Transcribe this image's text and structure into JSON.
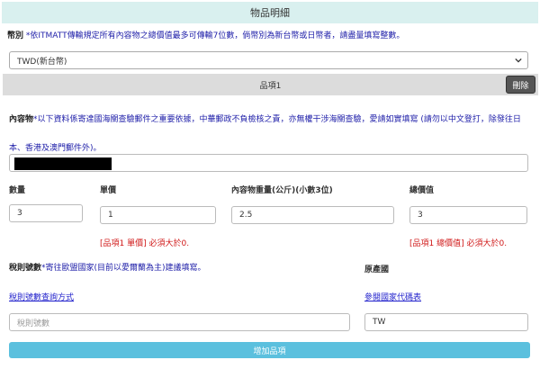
{
  "header": {
    "title": "物品明細"
  },
  "currency": {
    "label": "幣別",
    "note": "*依ITMATT傳輸規定所有內容物之總價值最多可傳輸7位數，倘幣別為新台幣或日幣者，請盡量填寫整數。",
    "selected": "TWD(新台幣)"
  },
  "item": {
    "title": "品項1",
    "delete_label": "刪除",
    "contents_label": "內容物",
    "contents_note": "*以下資料係寄達國海關查驗郵件之重要依據，中華郵政不負檢核之責，亦無權干涉海關查驗，愛請如實填寫 (請勿以中文登打，除發往日本、香港及澳門郵件外)。"
  },
  "fields": {
    "quantity": {
      "label": "數量",
      "value": "3"
    },
    "unit_price": {
      "label": "單價",
      "value": "1",
      "error": "[品項1 單價] 必須大於0."
    },
    "weight": {
      "label": "內容物重量(公斤)(小數3位)",
      "value": "2.5"
    },
    "total_value": {
      "label": "總價值",
      "value": "3",
      "error": "[品項1 總價值] 必須大於0."
    }
  },
  "tax": {
    "label": "稅則號數",
    "note": "*寄往歐盟國家(目前以愛爾蘭為主)建議填寫。",
    "link": "稅則號數查詢方式",
    "placeholder": "稅則號數"
  },
  "origin": {
    "label": "原產國",
    "link": "參閱國家代碼表",
    "value": "TW"
  },
  "add_button": {
    "label": "增加品項"
  }
}
